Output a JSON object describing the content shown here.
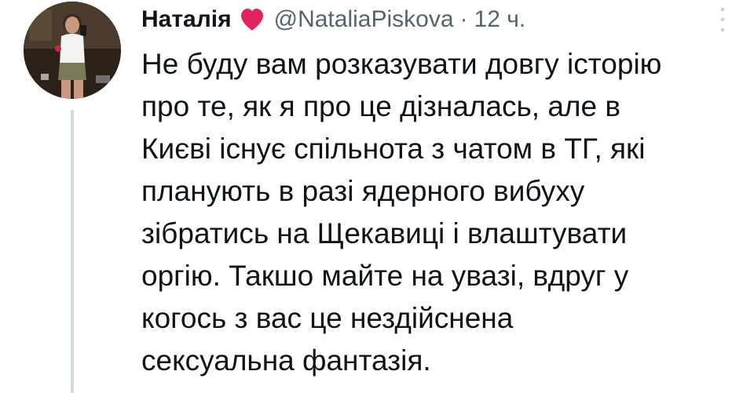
{
  "author": {
    "display_name": "Наталія",
    "badge_icon": "heart-icon",
    "badge_color": "#e0245e",
    "handle": "@NataliaPiskova",
    "separator": "·",
    "time": "12 ч."
  },
  "menu_icon": "more-options-icon",
  "tweet": {
    "lines": [
      "Не буду вам розказувати довгу історію",
      "про те, як я про це дізналась, але в",
      "Києві існує спільнота з чатом в ТГ, які",
      "планують в разі ядерного вибуху",
      "зібратись на Щекавиці і влаштувати",
      "оргію. Такшо майте на увазі, вдруг у",
      "когось з вас це нездійснена",
      "сексуальна фантазія."
    ]
  },
  "colors": {
    "text_primary": "#0f1419",
    "text_secondary": "#536471",
    "thread_line": "#cfd9de"
  }
}
